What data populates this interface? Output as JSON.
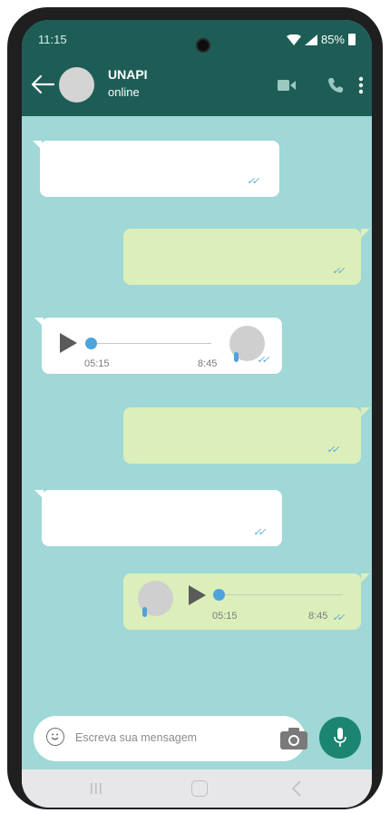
{
  "status": {
    "time": "11:15",
    "battery": "85%"
  },
  "contact": {
    "name": "UNAPI",
    "status": "online"
  },
  "messages": {
    "audio_in": {
      "duration": "05:15",
      "time": "8:45"
    },
    "audio_out": {
      "duration": "05:15",
      "time": "8:45"
    }
  },
  "input": {
    "placeholder": "Escreva sua mensagem"
  },
  "colors": {
    "header": "#1d5d55",
    "chat_background": "#9fd8d6",
    "outgoing_bubble": "#dcefbb",
    "incoming_bubble": "#ffffff",
    "mic_button": "#1b8570",
    "tick": "#58a8d8"
  },
  "icons": [
    "back-arrow-icon",
    "video-call-icon",
    "phone-icon",
    "menu-dots-icon",
    "play-icon",
    "mic-icon",
    "emoji-icon",
    "camera-icon",
    "double-tick-icon",
    "nav-recent-icon",
    "nav-home-icon",
    "nav-back-icon"
  ]
}
